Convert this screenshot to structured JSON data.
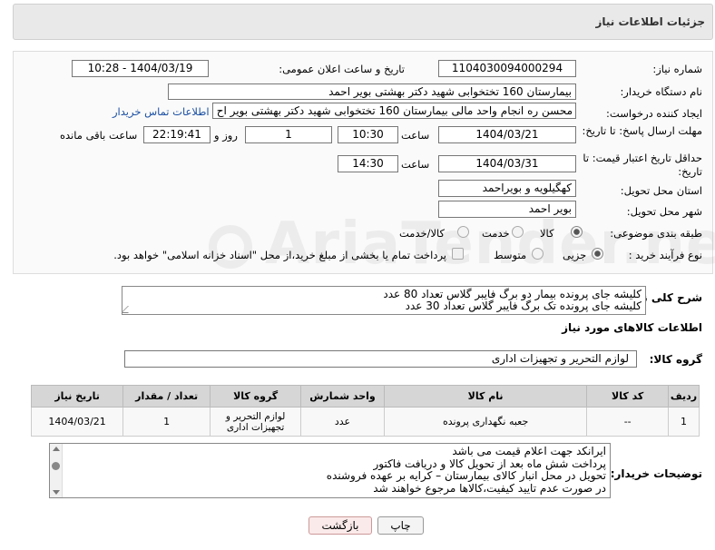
{
  "header": {
    "title": "جزئیات اطلاعات نیاز"
  },
  "labels": {
    "need_number": "شماره نیاز:",
    "announce_datetime": "تاریخ و ساعت اعلان عمومی:",
    "buyer_org": "نام دستگاه خریدار:",
    "requester": "ایجاد کننده درخواست:",
    "send_deadline": "مهلت ارسال پاسخ: تا تاریخ:",
    "price_validity": "حداقل تاریخ اعتبار قیمت: تا تاریخ:",
    "time": "ساعت",
    "day_and": "روز و",
    "remaining": "ساعت باقی مانده",
    "province": "استان محل تحویل:",
    "city": "شهر محل تحویل:",
    "category": "طبقه بندی موضوعی:",
    "process_type": "نوع فرآیند خرید :",
    "general_description": "شرح کلی نیاز:",
    "goods_info": "اطلاعات کالاهای مورد نیاز",
    "goods_group": "گروه کالا:",
    "buyer_notes": "توضیحات خریدار:"
  },
  "fields": {
    "need_number": "1104030094000294",
    "announce_datetime": "1404/03/19 - 10:28",
    "buyer_org": "بیمارستان 160 تختخوابی شهید دکتر بهشتی بویر احمد",
    "requester": "محسن ره انجام واحد مالی بیمارستان 160 تختخوابی شهید دکتر بهشتی بویر اح",
    "contact_link": "اطلاعات تماس خریدار",
    "send_deadline_date": "1404/03/21",
    "send_deadline_time": "10:30",
    "days": "1",
    "remaining_time": "22:19:41",
    "price_validity_date": "1404/03/31",
    "price_validity_time": "14:30",
    "province": "کهگیلویه و بویراحمد",
    "city": "بویر احمد"
  },
  "category_options": [
    "کالا",
    "خدمت",
    "کالا/خدمت"
  ],
  "category_selected": "کالا",
  "process_options": [
    "جزیی",
    "متوسط"
  ],
  "process_selected": "جزیی",
  "payment_note": "پرداخت تمام یا بخشی از مبلغ خرید،از محل \"اسناد خزانه اسلامی\" خواهد بود.",
  "description_lines": [
    "کلیشه جای پرونده بیمار دو برگ فایبر گلاس تعداد 80 عدد",
    "کلیشه جای پرونده تک برگ فایبر گلاس تعداد 30 عدد"
  ],
  "goods_group_value": "لوازم التحریر و تجهیزات اداری",
  "table": {
    "headers": [
      "ردیف",
      "کد کالا",
      "نام کالا",
      "واحد شمارش",
      "گروه کالا",
      "تعداد / مقدار",
      "تاریخ نیاز"
    ],
    "rows": [
      [
        "1",
        "--",
        "جعبه نگهداری پرونده",
        "عدد",
        "لوازم التحریر و تجهیزات اداری",
        "1",
        "1404/03/21"
      ]
    ]
  },
  "notes_lines": [
    "ایرانکد جهت اعلام قیمت می باشد",
    "پرداخت شش ماه بعد از تحویل کالا و دریافت فاکتور",
    "تحویل در محل انبار کالای بیمارستان – کرایه بر عهده فروشنده",
    "در صورت عدم تایید کیفیت،کالاها مرجوع خواهند شد"
  ],
  "buttons": {
    "print": "چاپ",
    "back": "بازگشت"
  },
  "watermark": "AriaTender.neT"
}
